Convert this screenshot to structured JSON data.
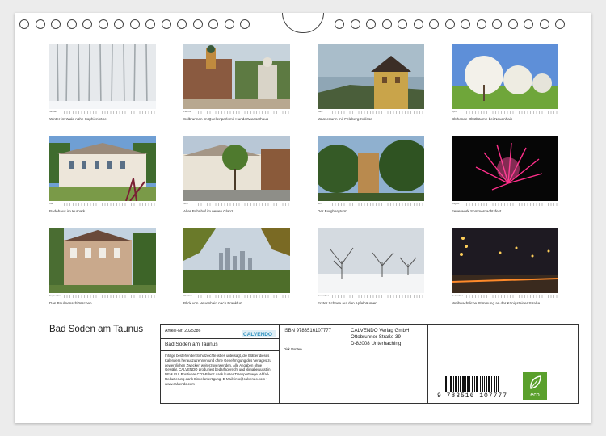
{
  "calendar": {
    "title": "Bad Soden am Taunus",
    "months": [
      {
        "name": "Januar",
        "caption": "Winter im Wald nähe Sophienhöhe"
      },
      {
        "name": "Februar",
        "caption": "Solbrunnen im Quellenpark mit Hundertwasserhaus"
      },
      {
        "name": "März",
        "caption": "Wasserturm mit Feldberg-Kulisse"
      },
      {
        "name": "April",
        "caption": "Blühende Obstbäume bei Neuenhain"
      },
      {
        "name": "Mai",
        "caption": "Badehaus im Kurpark"
      },
      {
        "name": "Juni",
        "caption": "Alter Bahnhof im neuen Glanz"
      },
      {
        "name": "Juli",
        "caption": "Der Burgbergturm"
      },
      {
        "name": "August",
        "caption": "Feuerwerk Sommernachtsfest"
      },
      {
        "name": "September",
        "caption": "Das Paulinenschlösschen"
      },
      {
        "name": "Oktober",
        "caption": "Blick von Neuenhain nach Frankfurt"
      },
      {
        "name": "November",
        "caption": "Erster Schnee auf den Apfelbäumen"
      },
      {
        "name": "Dezember",
        "caption": "Weihnachtliche Stimmung an der Königsteiner Straße"
      }
    ]
  },
  "info": {
    "article": "Artikel-Nr. 2025386",
    "publisher_logo": "CALVENDO",
    "calendar_title": "Bad Soden am Taunus",
    "description": "Infolge bestehender Schulzeichte ist es untersagt, die Blätter dieses Kalenders herauszutrennen und ohne Genehmigung des Verlages zu gewerblichen Zwecken weiterzuverwenden. Alle Angaben ohne Gewähr. CALVENDO produziert bedarfsgerecht und klimabewusst in DE & EU. Positivere CO2-Bilanz dank kurzer Transportwege. Abfall-Reduzierung dank Einzelanfertigung. E-Mail: info@calvendo.com • www.calvendo.com",
    "isbn": "ISBN 9783516107777",
    "author": "Dirk Vonten",
    "publisher_name": "CALVENDO Verlag GmbH",
    "publisher_street": "Ottobrunner Straße 39",
    "publisher_city": "D-82008 Unterhaching",
    "barcode_number": "9 783516 107777",
    "eco_label": "eco"
  },
  "colors": {
    "eco_green": "#5aa02c",
    "calvendo_accent": "#2a8fbd"
  }
}
